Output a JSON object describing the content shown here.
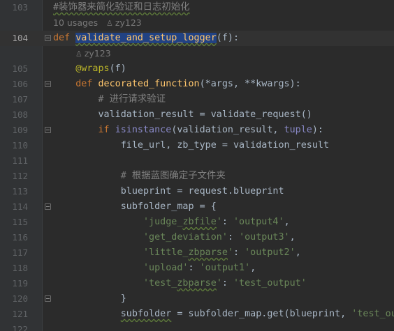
{
  "editor": {
    "lines": [
      {
        "num": "103",
        "kind": "code",
        "tokens": [
          {
            "t": "#装饰器来简化验证和日志初始化",
            "c": "cmt typo"
          }
        ]
      },
      {
        "num": "",
        "kind": "hint",
        "indent": 76,
        "usages": "10 usages",
        "author": "zy123"
      },
      {
        "num": "104",
        "kind": "code",
        "current": true,
        "fold": true,
        "tokens": [
          {
            "t": "def ",
            "c": "kw"
          },
          {
            "t": "validate_and_setup_logger",
            "c": "fn sel typo"
          },
          {
            "t": "(f):",
            "c": ""
          }
        ]
      },
      {
        "num": "",
        "kind": "hint",
        "indent": 108,
        "usages": "",
        "author": "zy123"
      },
      {
        "num": "105",
        "kind": "code",
        "tokens": [
          {
            "t": "    "
          },
          {
            "t": "@wraps",
            "c": "deco"
          },
          {
            "t": "(f)"
          }
        ]
      },
      {
        "num": "106",
        "kind": "code",
        "fold": true,
        "tokens": [
          {
            "t": "    "
          },
          {
            "t": "def ",
            "c": "kw"
          },
          {
            "t": "decorated_function",
            "c": "fn"
          },
          {
            "t": "(*args, **kwargs):"
          }
        ]
      },
      {
        "num": "107",
        "kind": "code",
        "tokens": [
          {
            "t": "        "
          },
          {
            "t": "# 进行请求验证",
            "c": "cmt"
          }
        ]
      },
      {
        "num": "108",
        "kind": "code",
        "tokens": [
          {
            "t": "        validation_result = validate_request()"
          }
        ]
      },
      {
        "num": "109",
        "kind": "code",
        "fold": true,
        "tokens": [
          {
            "t": "        "
          },
          {
            "t": "if ",
            "c": "kw"
          },
          {
            "t": "isinstance",
            "c": "builtin"
          },
          {
            "t": "(validation_result, "
          },
          {
            "t": "tuple",
            "c": "builtin"
          },
          {
            "t": "):"
          }
        ]
      },
      {
        "num": "110",
        "kind": "code",
        "tokens": [
          {
            "t": "            file_url, zb_type = validation_result"
          }
        ]
      },
      {
        "num": "111",
        "kind": "code",
        "tokens": [
          {
            "t": ""
          }
        ]
      },
      {
        "num": "112",
        "kind": "code",
        "tokens": [
          {
            "t": "            "
          },
          {
            "t": "# 根据蓝图确定子文件夹",
            "c": "cmt"
          }
        ]
      },
      {
        "num": "113",
        "kind": "code",
        "tokens": [
          {
            "t": "            blueprint = request.blueprint"
          }
        ]
      },
      {
        "num": "114",
        "kind": "code",
        "fold": true,
        "tokens": [
          {
            "t": "            subfolder_map = {"
          }
        ]
      },
      {
        "num": "115",
        "kind": "code",
        "tokens": [
          {
            "t": "                "
          },
          {
            "t": "'judge_",
            "c": "str"
          },
          {
            "t": "zbfile",
            "c": "str typo"
          },
          {
            "t": "'",
            "c": "str"
          },
          {
            "t": ": "
          },
          {
            "t": "'output4'",
            "c": "str"
          },
          {
            "t": ","
          }
        ]
      },
      {
        "num": "116",
        "kind": "code",
        "tokens": [
          {
            "t": "                "
          },
          {
            "t": "'get_deviation'",
            "c": "str"
          },
          {
            "t": ": "
          },
          {
            "t": "'output3'",
            "c": "str"
          },
          {
            "t": ","
          }
        ]
      },
      {
        "num": "117",
        "kind": "code",
        "tokens": [
          {
            "t": "                "
          },
          {
            "t": "'little_",
            "c": "str"
          },
          {
            "t": "zbparse",
            "c": "str typo"
          },
          {
            "t": "'",
            "c": "str"
          },
          {
            "t": ": "
          },
          {
            "t": "'output2'",
            "c": "str"
          },
          {
            "t": ","
          }
        ]
      },
      {
        "num": "118",
        "kind": "code",
        "tokens": [
          {
            "t": "                "
          },
          {
            "t": "'upload'",
            "c": "str"
          },
          {
            "t": ": "
          },
          {
            "t": "'output1'",
            "c": "str"
          },
          {
            "t": ","
          }
        ]
      },
      {
        "num": "119",
        "kind": "code",
        "tokens": [
          {
            "t": "                "
          },
          {
            "t": "'test_",
            "c": "str"
          },
          {
            "t": "zbparse",
            "c": "str typo"
          },
          {
            "t": "'",
            "c": "str"
          },
          {
            "t": ": "
          },
          {
            "t": "'test_output'",
            "c": "str"
          }
        ]
      },
      {
        "num": "120",
        "kind": "code",
        "fold_end": true,
        "tokens": [
          {
            "t": "            }"
          }
        ]
      },
      {
        "num": "121",
        "kind": "code",
        "tokens": [
          {
            "t": "            "
          },
          {
            "t": "subfolder",
            "c": "typo"
          },
          {
            "t": " = subfolder_map.get(blueprint, "
          },
          {
            "t": "'test_output'",
            "c": "str"
          },
          {
            "t": ")"
          }
        ]
      },
      {
        "num": "122",
        "kind": "code",
        "tokens": [
          {
            "t": ""
          }
        ]
      }
    ]
  },
  "colors": {
    "background": "#2b2b2b",
    "gutter": "#313335",
    "keyword": "#cc7832",
    "function": "#ffc66d",
    "decorator": "#bbb529",
    "string": "#6a8759",
    "comment": "#808080",
    "builtin": "#8888c6",
    "selection": "#214283",
    "text": "#a9b7c6"
  },
  "icons": {
    "author": "user-icon"
  }
}
